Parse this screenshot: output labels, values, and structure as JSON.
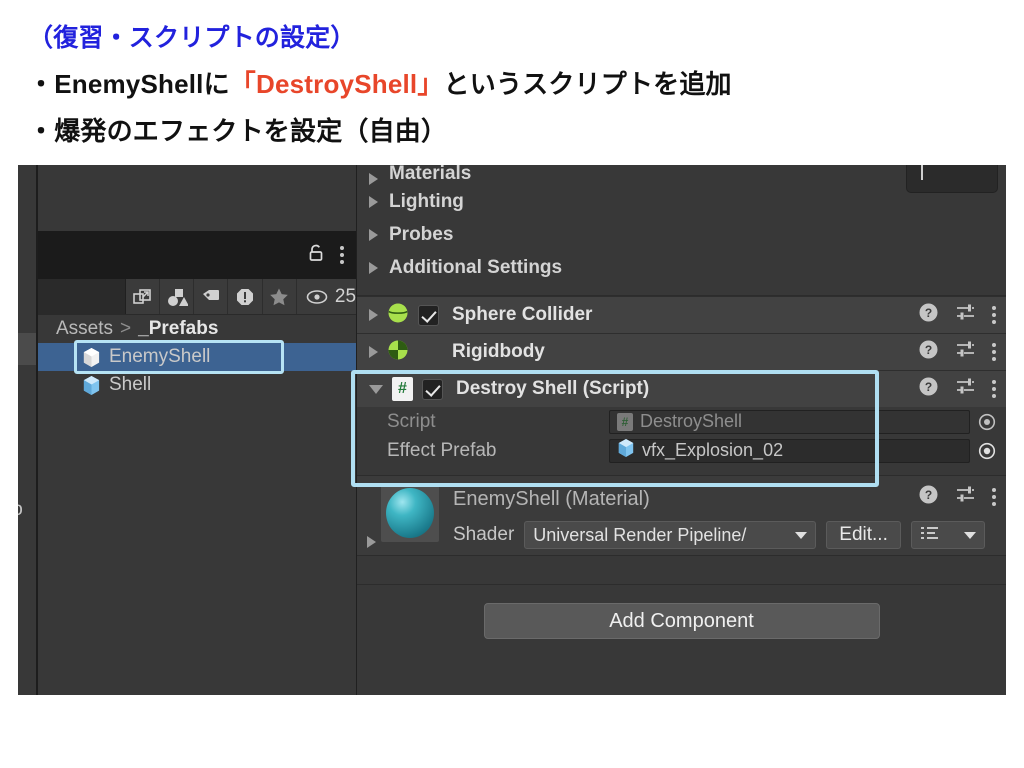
{
  "slide": {
    "title": "（復習・スクリプトの設定）",
    "bullet1_prefix": "・EnemyShellに",
    "bullet1_highlight": "「DestroyShell」",
    "bullet1_suffix": "というスクリプトを追加",
    "bullet2": "・爆発のエフェクトを設定（自由）",
    "title_color": "#2222dd",
    "highlight_color": "#e8462a"
  },
  "editor": {
    "left_sliver": {
      "cut_text": "io"
    },
    "project_panel": {
      "toolbar": {
        "search_placeholder": "",
        "icons": [
          "expand-icon",
          "shapes-filter-icon",
          "label-filter-icon",
          "warning-filter-icon",
          "favorite-filter-icon"
        ],
        "visible_count": "25"
      },
      "titlebar_icons": [
        "lock-icon",
        "kebab-menu-icon"
      ],
      "breadcrumb": {
        "root": "Assets",
        "separator": ">",
        "current": "_Prefabs"
      },
      "assets": [
        {
          "name": "EnemyShell",
          "selected": true,
          "highlighted": true
        },
        {
          "name": "Shell",
          "selected": false,
          "highlighted": false
        }
      ],
      "selection_color": "#3d6392",
      "highlight_color": "#b6e3f4"
    },
    "inspector": {
      "foldouts": [
        {
          "label": "Materials"
        },
        {
          "label": "Lighting"
        },
        {
          "label": "Probes"
        },
        {
          "label": "Additional Settings"
        }
      ],
      "components": [
        {
          "name": "Sphere Collider",
          "icon": "sphere-collider-icon",
          "enabled": true,
          "has_checkbox": true,
          "expanded": false,
          "highlighted": false
        },
        {
          "name": "Rigidbody",
          "icon": "rigidbody-icon",
          "enabled": true,
          "has_checkbox": false,
          "expanded": false,
          "highlighted": false
        },
        {
          "name": "Destroy Shell (Script)",
          "icon": "cs-script-icon",
          "enabled": true,
          "has_checkbox": true,
          "expanded": true,
          "highlighted": true,
          "properties": [
            {
              "label": "Script",
              "value": "DestroyShell",
              "icon": "cs-script-icon",
              "dimmed": true
            },
            {
              "label": "Effect Prefab",
              "value": "vfx_Explosion_02",
              "icon": "prefab-cube-icon",
              "dimmed": false
            }
          ]
        }
      ],
      "component_action_icons": [
        "help-icon",
        "preset-icon",
        "kebab-menu-icon"
      ],
      "material": {
        "name": "EnemyShell (Material)",
        "shader_label": "Shader",
        "shader_value": "Universal Render Pipeline/",
        "edit_button": "Edit...",
        "preset_icon": "preset-list-icon"
      },
      "add_component_button": "Add Component",
      "highlight_color": "#b0dff2"
    }
  }
}
